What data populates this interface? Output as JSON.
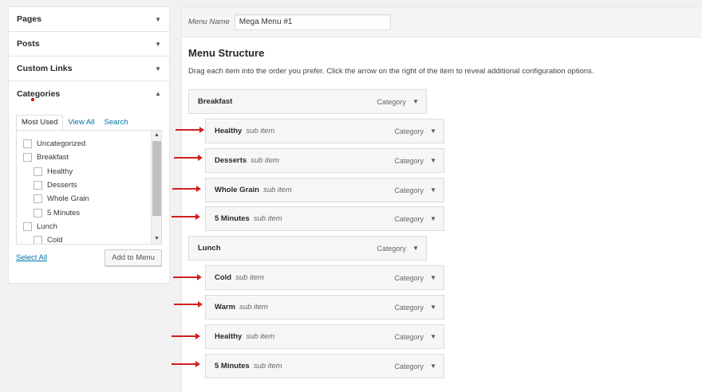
{
  "sidebar": {
    "sections": [
      {
        "label": "Pages",
        "arrow": "▼"
      },
      {
        "label": "Posts",
        "arrow": "▼"
      },
      {
        "label": "Custom Links",
        "arrow": "▼"
      },
      {
        "label": "Categories",
        "arrow": "▲"
      }
    ],
    "tabs": [
      "Most Used",
      "View All",
      "Search"
    ],
    "categories": [
      {
        "label": "Uncategorized",
        "level": 0
      },
      {
        "label": "Breakfast",
        "level": 0
      },
      {
        "label": "Healthy",
        "level": 1
      },
      {
        "label": "Desserts",
        "level": 1
      },
      {
        "label": "Whole Grain",
        "level": 1
      },
      {
        "label": "5 Minutes",
        "level": 1
      },
      {
        "label": "Lunch",
        "level": 0
      },
      {
        "label": "Cold",
        "level": 1
      }
    ],
    "select_all": "Select All",
    "add_button": "Add to Menu"
  },
  "menu": {
    "name_label": "Menu Name",
    "name_value": "Mega Menu #1",
    "structure_title": "Menu Structure",
    "structure_desc": "Drag each item into the order you prefer. Click the arrow on the right of the item to reveal additional configuration options.",
    "items": [
      {
        "title": "Breakfast",
        "sub": "",
        "type": "Category",
        "level": 0
      },
      {
        "title": "Healthy",
        "sub": "sub item",
        "type": "Category",
        "level": 1
      },
      {
        "title": "Desserts",
        "sub": "sub item",
        "type": "Category",
        "level": 1
      },
      {
        "title": "Whole Grain",
        "sub": "sub item",
        "type": "Category",
        "level": 1
      },
      {
        "title": "5 Minutes",
        "sub": "sub item",
        "type": "Category",
        "level": 1
      },
      {
        "title": "Lunch",
        "sub": "",
        "type": "Category",
        "level": 0
      },
      {
        "title": "Cold",
        "sub": "sub item",
        "type": "Category",
        "level": 1
      },
      {
        "title": "Warm",
        "sub": "sub item",
        "type": "Category",
        "level": 1
      },
      {
        "title": "Healthy",
        "sub": "sub item",
        "type": "Category",
        "level": 1
      },
      {
        "title": "5 Minutes",
        "sub": "sub item",
        "type": "Category",
        "level": 1
      }
    ]
  },
  "colors": {
    "accent": "#0073aa",
    "annotation_arrow": "#d21f1f"
  }
}
